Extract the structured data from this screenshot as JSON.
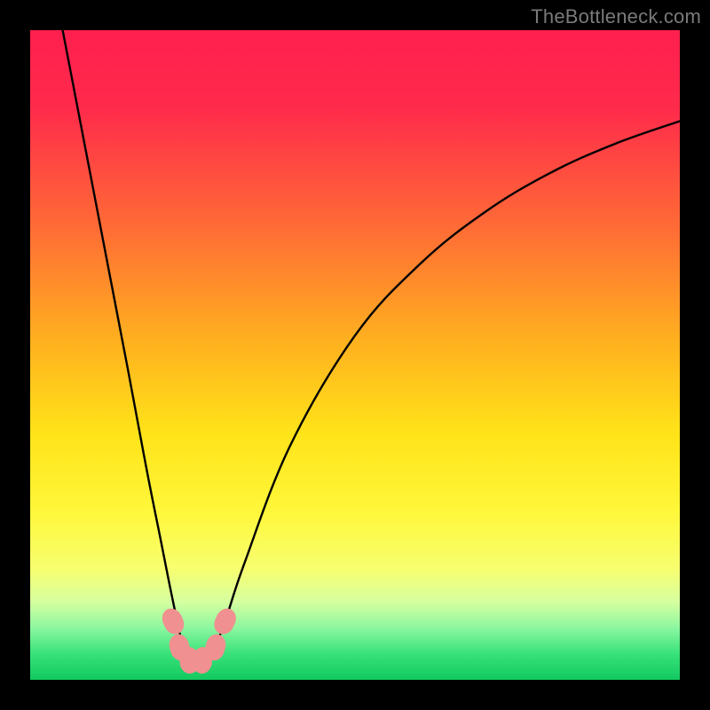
{
  "watermark": {
    "text": "TheBottleneck.com"
  },
  "chart_data": {
    "type": "line",
    "title": "",
    "xlabel": "",
    "ylabel": "",
    "xlim": [
      0,
      100
    ],
    "ylim": [
      0,
      100
    ],
    "grid": false,
    "series": [
      {
        "name": "curve",
        "x": [
          5,
          10,
          15,
          18,
          20,
          22,
          23.8,
          25,
          26,
          27,
          28,
          30,
          33,
          40,
          50,
          60,
          70,
          80,
          90,
          100
        ],
        "values": [
          100,
          74,
          48,
          32,
          22,
          12,
          4,
          3,
          2,
          2.5,
          4,
          9,
          18,
          36,
          53,
          64,
          72,
          78,
          82.5,
          86
        ]
      }
    ],
    "markers": [
      {
        "x": 22.0,
        "y": 9.0
      },
      {
        "x": 23.0,
        "y": 5.0
      },
      {
        "x": 24.5,
        "y": 3.0
      },
      {
        "x": 26.5,
        "y": 3.0
      },
      {
        "x": 28.5,
        "y": 5.0
      },
      {
        "x": 30.0,
        "y": 9.0
      }
    ],
    "background_gradient_stops": [
      {
        "pct": 0,
        "color": "#ff1f4f"
      },
      {
        "pct": 12,
        "color": "#ff2b4b"
      },
      {
        "pct": 30,
        "color": "#ff6a36"
      },
      {
        "pct": 48,
        "color": "#ffb11f"
      },
      {
        "pct": 62,
        "color": "#ffe319"
      },
      {
        "pct": 74,
        "color": "#fff73a"
      },
      {
        "pct": 83,
        "color": "#f7ff70"
      },
      {
        "pct": 88,
        "color": "#d6ffa0"
      },
      {
        "pct": 92,
        "color": "#8cf7a0"
      },
      {
        "pct": 96,
        "color": "#38e27a"
      },
      {
        "pct": 100,
        "color": "#12c95f"
      }
    ]
  }
}
